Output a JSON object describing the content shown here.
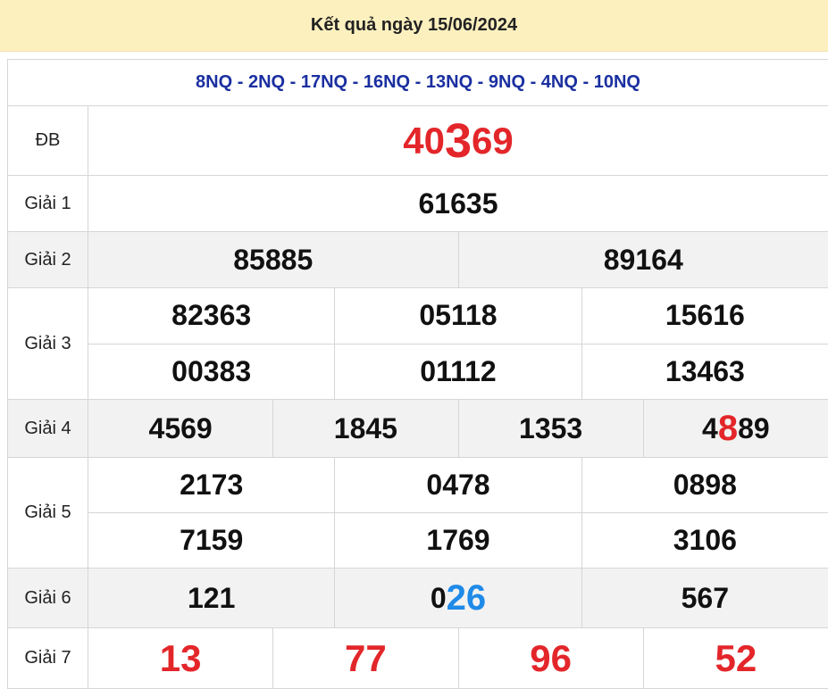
{
  "header": {
    "title": "Kết quả ngày 15/06/2024"
  },
  "codes": "8NQ - 2NQ - 17NQ - 16NQ - 13NQ - 9NQ - 4NQ - 10NQ",
  "prizes": {
    "db": {
      "label": "ĐB",
      "prefix": "40",
      "highlight": "3",
      "suffix": "69"
    },
    "g1": {
      "label": "Giải 1",
      "values": [
        "61635"
      ]
    },
    "g2": {
      "label": "Giải 2",
      "values": [
        "85885",
        "89164"
      ]
    },
    "g3": {
      "label": "Giải 3",
      "values": [
        "82363",
        "05118",
        "15616",
        "00383",
        "01112",
        "13463"
      ]
    },
    "g4": {
      "label": "Giải 4",
      "values": [
        "4569",
        "1845",
        "1353"
      ],
      "last": {
        "prefix": "4",
        "highlight": "8",
        "suffix": "89"
      }
    },
    "g5": {
      "label": "Giải 5",
      "values": [
        "2173",
        "0478",
        "0898",
        "7159",
        "1769",
        "3106"
      ]
    },
    "g6": {
      "label": "Giải 6",
      "first": "121",
      "mid": {
        "prefix": "0",
        "highlight": "26"
      },
      "last": "567"
    },
    "g7": {
      "label": "Giải 7",
      "values": [
        "13",
        "77",
        "96",
        "52"
      ]
    }
  },
  "colors": {
    "header_bg": "#fdf0bf",
    "codes": "#1a2fa0",
    "red": "#e3262a",
    "blue": "#1f8ae8",
    "alt_row": "#f2f2f2"
  }
}
